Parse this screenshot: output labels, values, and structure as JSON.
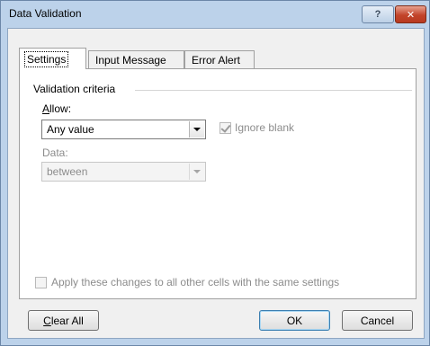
{
  "window": {
    "title": "Data Validation",
    "help_label": "?",
    "close_label": "✕"
  },
  "tabs": [
    {
      "label": "Settings",
      "active": true
    },
    {
      "label": "Input Message",
      "active": false
    },
    {
      "label": "Error Alert",
      "active": false
    }
  ],
  "settings": {
    "section_label": "Validation criteria",
    "allow_label_mnemonic": "A",
    "allow_label_rest": "llow:",
    "allow_value": "Any value",
    "ignore_blank_label": "Ignore blank",
    "ignore_blank_checked": true,
    "data_label": "Data:",
    "data_value": "between",
    "apply_all_label": "Apply these changes to all other cells with the same settings",
    "apply_all_checked": false
  },
  "buttons": {
    "clear_all_mnemonic": "C",
    "clear_all_rest": "lear All",
    "ok": "OK",
    "cancel": "Cancel"
  },
  "colors": {
    "frame": "#bcd2ea",
    "close_button": "#c2442a",
    "client_bg": "#f0f0f0"
  }
}
